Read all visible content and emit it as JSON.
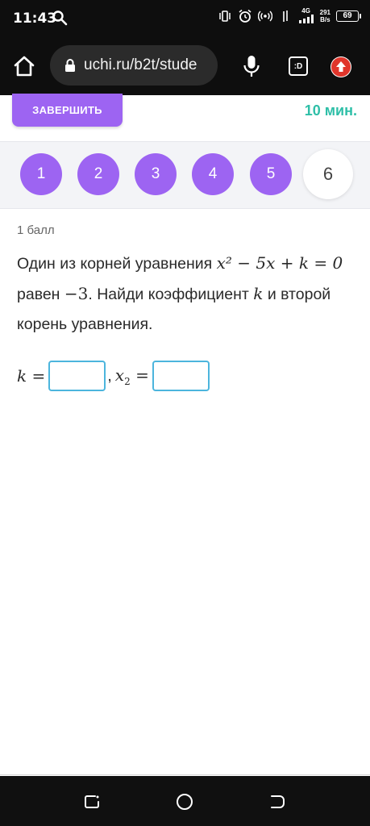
{
  "status_bar": {
    "time": "11:43",
    "network": "4G",
    "speed_value": "291",
    "speed_unit": "B/s",
    "battery": "69"
  },
  "browser": {
    "url": "uchi.ru/b2t/stude",
    "tabs_label": ":D"
  },
  "header": {
    "finish_label": "ЗАВЕРШИТЬ",
    "timer": "10 мин."
  },
  "question_nav": {
    "items": [
      "1",
      "2",
      "3",
      "4",
      "5",
      "6"
    ],
    "current": "6"
  },
  "task": {
    "points": "1 балл",
    "text_1": "Один из корней уравнения",
    "equation": "x² − 5x + k = 0",
    "text_2": "равен",
    "root": "−3",
    "text_3": ". Найди коэффициент",
    "var_k": "k",
    "text_4": "и второй корень уравнения."
  },
  "answer": {
    "k_label": "k =",
    "separator": ",",
    "x2_var": "x",
    "x2_sub": "2",
    "x2_eq": "=",
    "k_value": "",
    "x2_value": ""
  },
  "colors": {
    "accent": "#9d64f2",
    "timer": "#2fbfa8",
    "input_border": "#4cb5dd"
  }
}
